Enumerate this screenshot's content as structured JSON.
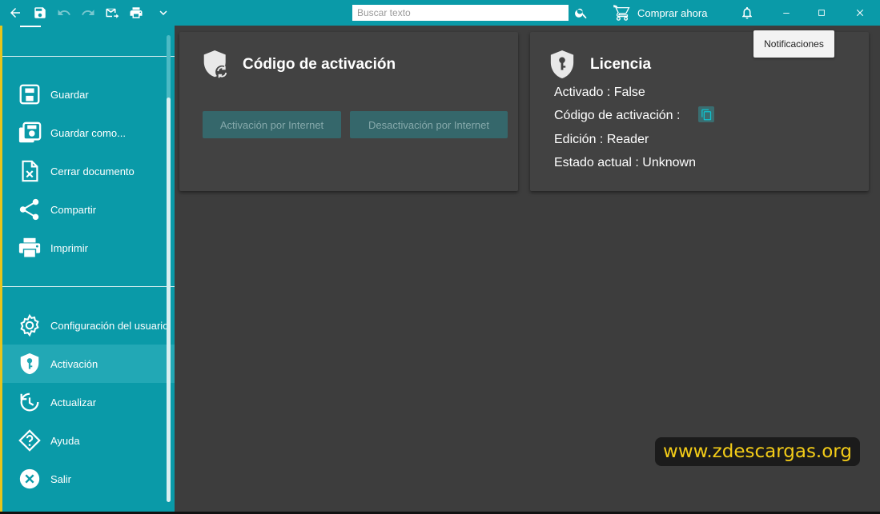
{
  "titlebar": {
    "search_placeholder": "Buscar texto",
    "buy_label": "Comprar ahora",
    "icons": [
      "arrow-left-icon",
      "save-icon",
      "undo-icon",
      "redo-icon",
      "mail-send-icon",
      "printer-icon",
      "chevron-down-icon",
      "search-icon",
      "cart-icon",
      "bell-icon",
      "minimize-icon",
      "maximize-icon",
      "close-icon"
    ]
  },
  "tooltip": {
    "text": "Notificaciones"
  },
  "sidebar": {
    "items": [
      {
        "label": "Guardar",
        "icon": "save-icon"
      },
      {
        "label": "Guardar como...",
        "icon": "save-as-icon"
      },
      {
        "label": "Cerrar documento",
        "icon": "close-document-icon"
      },
      {
        "label": "Compartir",
        "icon": "share-icon"
      },
      {
        "label": "Imprimir",
        "icon": "printer-icon"
      },
      {
        "label": "Configuración del usuario",
        "icon": "gear-icon"
      },
      {
        "label": "Activación",
        "icon": "shield-key-icon"
      },
      {
        "label": "Actualizar",
        "icon": "update-icon"
      },
      {
        "label": "Ayuda",
        "icon": "help-icon"
      },
      {
        "label": "Salir",
        "icon": "exit-icon"
      }
    ],
    "active": "Activación"
  },
  "activation": {
    "title": "Código de activación",
    "btn_online": "Activación por Internet",
    "btn_deactivate": "Desactivación por Internet"
  },
  "license": {
    "title": "Licencia",
    "activated": "Activado : False",
    "activation_code": "Código de activación :",
    "edition": "Edición : Reader",
    "status": "Estado actual : Unknown"
  },
  "watermark": {
    "text": "www.zdescargas.org"
  },
  "colors": {
    "accent": "#0a9aa8",
    "sidebar_active": "#22a8b5",
    "main_bg": "#3d3d3d",
    "card_bg": "#424242",
    "watermark_text": "#f3cc18"
  }
}
